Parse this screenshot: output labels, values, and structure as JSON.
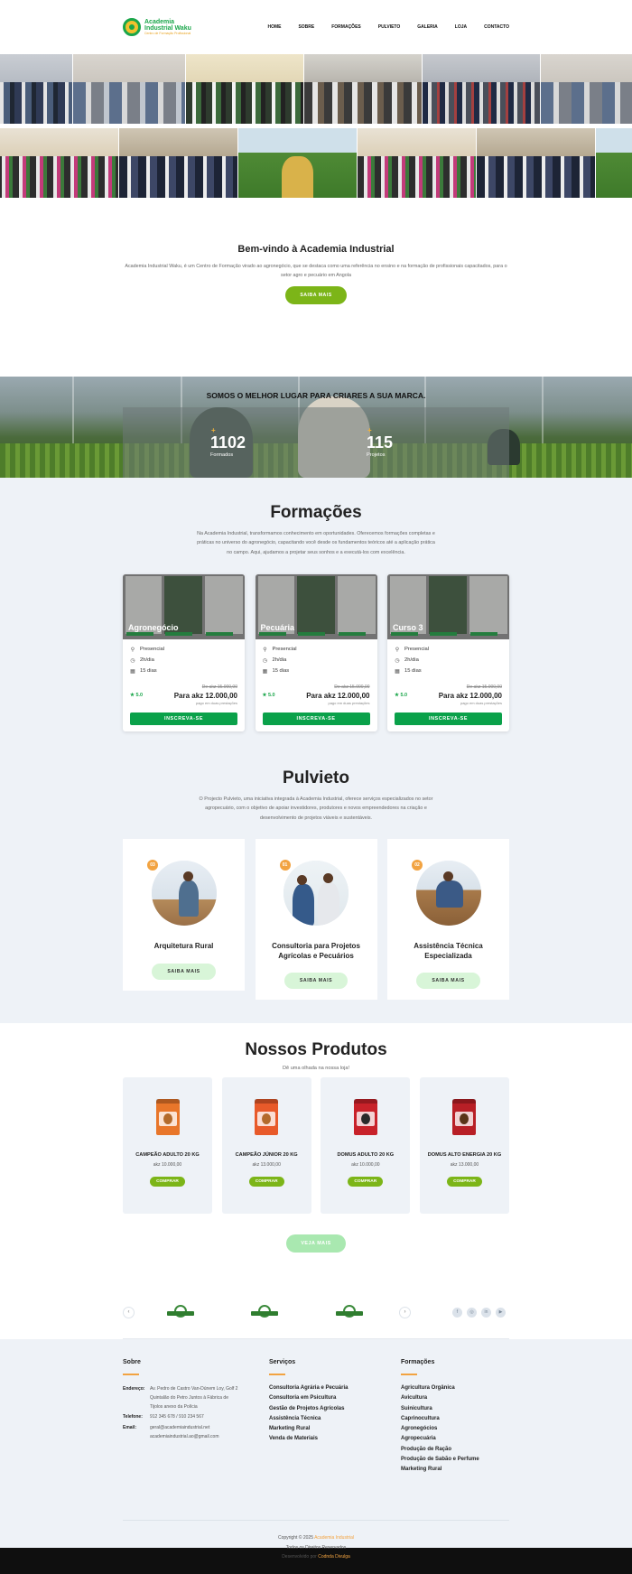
{
  "header": {
    "logo_line1": "Academia",
    "logo_line2": "Industrial Waku",
    "logo_tagline": "Centro de Formação Profissional",
    "nav": [
      "HOME",
      "SOBRE",
      "FORMAÇÕES",
      "PULVIETO",
      "GALERIA",
      "LOJA",
      "CONTACTO"
    ]
  },
  "welcome": {
    "title": "Bem-vindo à Academia Industrial",
    "text": "Academia Industrial Waku, é um Centro de Formação virado ao agronegócio, que se destaca como uma referência no ensino e na formação de profissionais capacitados, para o setor agro e pecuário em Angola",
    "button": "SAIBA MAIS"
  },
  "stats": {
    "headline": "SOMOS O MELHOR LUGAR PARA CRIARES A SUA MARCA.",
    "items": [
      {
        "plus": "+",
        "value": "1102",
        "label": "Formados"
      },
      {
        "plus": "+",
        "value": "115",
        "label": "Projetos"
      }
    ]
  },
  "formacoes": {
    "title": "Formações",
    "description": "Na Academia Industrial, transformamos conhecimento em oportunidades. Oferecemos formações completas e práticas no universo do agronegócio, capacitando você desde os fundamentos teóricos até a aplicação prática no campo. Aqui, ajudamos a projetar seus sonhos e a executá-los com excelência.",
    "courses": [
      {
        "title": "Agronegócio",
        "mode": "Presencial",
        "hours": "2h/dia",
        "days": "15 dias",
        "rating": "★ 5.0",
        "old_price": "De akz 15.000,00",
        "price": "Para akz 12.000,00",
        "note": "pago em duas prestações",
        "button": "INSCREVA-SE"
      },
      {
        "title": "Pecuária",
        "mode": "Presencial",
        "hours": "2h/dia",
        "days": "15 dias",
        "rating": "★ 5.0",
        "old_price": "De akz 15.000,00",
        "price": "Para akz 12.000,00",
        "note": "pago em duas prestações",
        "button": "INSCREVA-SE"
      },
      {
        "title": "Curso 3",
        "mode": "Presencial",
        "hours": "2h/dia",
        "days": "15 dias",
        "rating": "★ 5.0",
        "old_price": "De akz 15.000,00",
        "price": "Para akz 12.000,00",
        "note": "pago em duas prestações",
        "button": "INSCREVA-SE"
      }
    ]
  },
  "pulvieto": {
    "title": "Pulvieto",
    "description": "O Projecto Pulvieto, uma iniciativa integrada à Academia Industrial, oferece serviços especializados no setor agropecuário, com o objetivo de apoiar investidores, produtores e novos empreendedores na criação e desenvolvimento de projetos viáveis e sustentáveis.",
    "services": [
      {
        "badge": "03",
        "title": "Arquitetura Rural",
        "button": "SAIBA MAIS"
      },
      {
        "badge": "01",
        "title": "Consultoria para Projetos Agrícolas e Pecuários",
        "button": "SAIBA MAIS"
      },
      {
        "badge": "02",
        "title": "Assistência Técnica Especializada",
        "button": "SAIBA MAIS"
      }
    ]
  },
  "produtos": {
    "title": "Nossos Produtos",
    "subtitle": "Dê uma olhada na nossa loja!",
    "items": [
      {
        "name": "CAMPEÃO ADULTO 20 KG",
        "price": "akz 10.000,00",
        "button": "COMPRAR",
        "color": "#e8762a"
      },
      {
        "name": "CAMPEÃO JÚNIOR 20 KG",
        "price": "akz 13.000,00",
        "button": "COMPRAR",
        "color": "#e85a2a"
      },
      {
        "name": "DOMUS ADULTO 20 KG",
        "price": "akz 10.000,00",
        "button": "COMPRAR",
        "color": "#c8222a"
      },
      {
        "name": "DOMUS ALTO ENERGIA 20 KG",
        "price": "akz 13.000,00",
        "button": "COMPRAR",
        "color": "#b81f26"
      }
    ],
    "more_button": "VEJA MAIS"
  },
  "partners": {
    "prev": "‹",
    "next": "›",
    "seal_text": "BIO",
    "social": [
      "f",
      "◎",
      "in",
      "▶"
    ]
  },
  "footer": {
    "sobre": {
      "title": "Sobre",
      "address_label": "Endereço:",
      "address": "Av. Pedro de Castro Van-Dúnem Loy, Golf 2 Quintalão do Petro Juntos à Fábrica de Tijolos anexo da Polícia",
      "phone_label": "Telefone:",
      "phone": "912 345 678 / 910 234 567",
      "email_label": "Email:",
      "email1": "geral@academiaindustrial.net",
      "email2": "academiaindustrial.ao@gmail.com"
    },
    "servicos": {
      "title": "Serviços",
      "items": [
        "Consultoria Agrária e Pecuária",
        "Consultoria em Psicultura",
        "Gestão de Projetos Agrícolas",
        "Assistência Técnica",
        "Marketing Rural",
        "Venda de Materiais"
      ]
    },
    "formacoes": {
      "title": "Formações",
      "items": [
        "Agricultura Orgânica",
        "Avicultura",
        "Suinicultura",
        "Caprinocultura",
        "Agronegócios",
        "Agropecuária",
        "Produção de Ração",
        "Produção de Sabão e Perfume",
        "Marketing Rural"
      ]
    },
    "copyright_prefix": "Copyright © 2025",
    "copyright_brand": "Academia Industrial",
    "rights": "Todos os Direitos Reservados",
    "dev_prefix": "Desenvolvido por",
    "dev_name": "Codnda Divulga"
  }
}
